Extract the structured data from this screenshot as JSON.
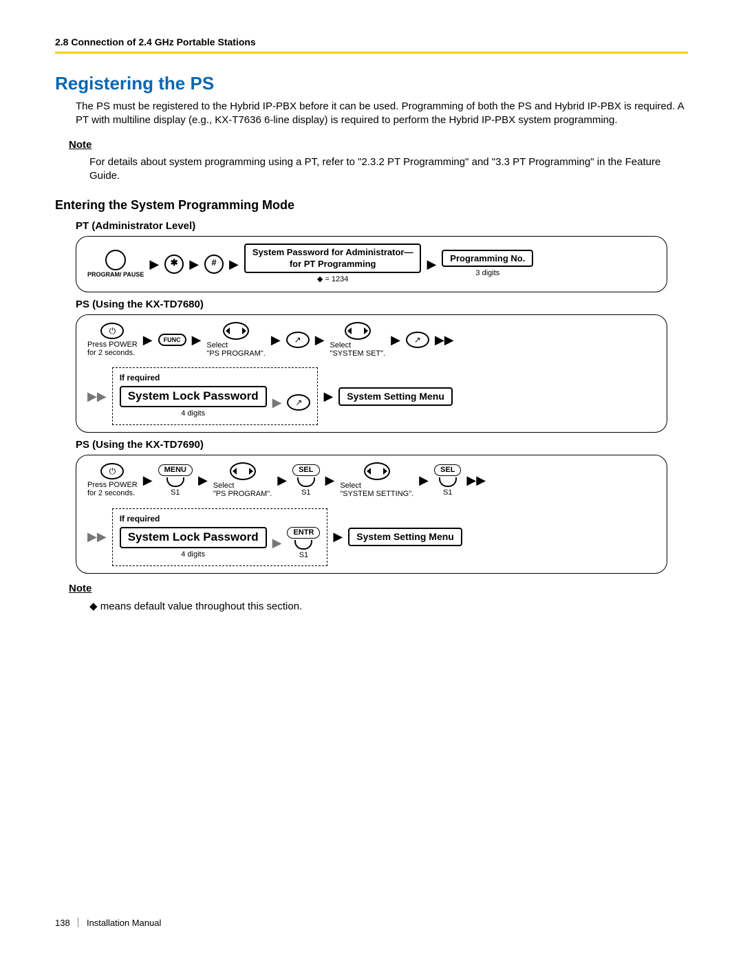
{
  "header": {
    "running": "2.8 Connection of 2.4 GHz Portable Stations"
  },
  "title": "Registering the PS",
  "intro": "The PS must be registered to the Hybrid IP-PBX before it can be used. Programming of both the PS and Hybrid IP-PBX is required. A PT with multiline display (e.g., KX-T7636 6-line display) is required to perform the Hybrid IP-PBX system programming.",
  "note1_label": "Note",
  "note1_text": "For details about system programming using a PT, refer to \"2.3.2 PT Programming\" and \"3.3 PT Programming\" in the Feature Guide.",
  "subsection": "Entering the System Programming Mode",
  "pt_admin": {
    "label": "PT (Administrator Level)",
    "program_key": "PROGRAM/\nPAUSE",
    "star": "✱",
    "hash": "#",
    "syspwd_box": "System Password for Administrator—\nfor PT Programming",
    "default": "◆ = 1234",
    "progno_box": "Programming No.",
    "digits": "3 digits"
  },
  "ps7680": {
    "label": "PS (Using the KX-TD7680)",
    "power_caption": "Press POWER\nfor 2 seconds.",
    "func": "FUNC",
    "select_psprog": "Select\n\"PS PROGRAM\".",
    "select_sysset": "Select\n\"SYSTEM SET\".",
    "ifreq": "If required",
    "lockpwd": "System Lock Password",
    "fourdigits": "4 digits",
    "menu": "System Setting Menu"
  },
  "ps7690": {
    "label": "PS (Using the KX-TD7690)",
    "power_caption": "Press POWER\nfor 2 seconds.",
    "menu_key": "MENU",
    "sel_key": "SEL",
    "entr_key": "ENTR",
    "s1": "S1",
    "select_psprog": "Select\n\"PS PROGRAM\".",
    "select_syssetting": "Select\n\"SYSTEM SETTING\".",
    "ifreq": "If required",
    "lockpwd": "System Lock Password",
    "fourdigits": "4 digits",
    "menu": "System Setting Menu"
  },
  "note2_label": "Note",
  "note2_text": "◆ means default value throughout this section.",
  "footer": {
    "page": "138",
    "doc": "Installation Manual"
  }
}
